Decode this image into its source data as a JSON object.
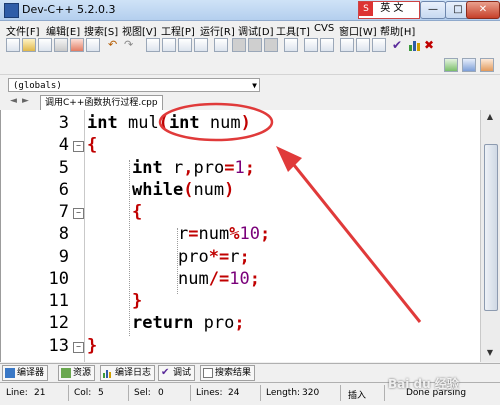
{
  "window": {
    "title": "Dev-C++ 5.2.0.3",
    "ime_text": "英 文"
  },
  "menu": [
    {
      "label": "文件[F]"
    },
    {
      "label": "编辑[E]"
    },
    {
      "label": "搜索[S]"
    },
    {
      "label": "视图[V]"
    },
    {
      "label": "工程[P]"
    },
    {
      "label": "运行[R]"
    },
    {
      "label": "调试[D]"
    },
    {
      "label": "工具[T]"
    },
    {
      "label": "CVS"
    },
    {
      "label": "窗口[W]"
    },
    {
      "label": "帮助[H]"
    }
  ],
  "scope_combo": {
    "value": "(globals)"
  },
  "editor_tab": {
    "label": "调用C++函数执行过程.cpp"
  },
  "code": {
    "line_numbers": [
      "3",
      "4",
      "5",
      "6",
      "7",
      "8",
      "9",
      "10",
      "11",
      "12",
      "13"
    ],
    "lines": [
      "int mul(int num)",
      "{",
      "int r,pro=1;",
      "while(num)",
      "{",
      "r=num%10;",
      "pro*=r;",
      "num/=10;",
      "}",
      "return pro;",
      "}"
    ]
  },
  "bottom_tabs": [
    {
      "label": "编译器",
      "icon": "compiler-icon"
    },
    {
      "label": "资源",
      "icon": "resource-icon"
    },
    {
      "label": "编译日志",
      "icon": "compile-log-icon"
    },
    {
      "label": "调试",
      "icon": "debug-icon"
    },
    {
      "label": "搜索结果",
      "icon": "search-results-icon"
    }
  ],
  "status": {
    "line_label": "Line:",
    "line_value": "21",
    "col_label": "Col:",
    "col_value": "5",
    "sel_label": "Sel:",
    "sel_value": "0",
    "lines_label": "Lines:",
    "lines_value": "24",
    "length_label": "Length:",
    "length_value": "320",
    "mode": "插入",
    "parse_status": "Done parsing"
  },
  "watermark": "Bai du 经验",
  "colors": {
    "annotation_red": "#e03a3a",
    "keyword": "#000000",
    "operator": "#c00000",
    "number": "#7a007a"
  }
}
